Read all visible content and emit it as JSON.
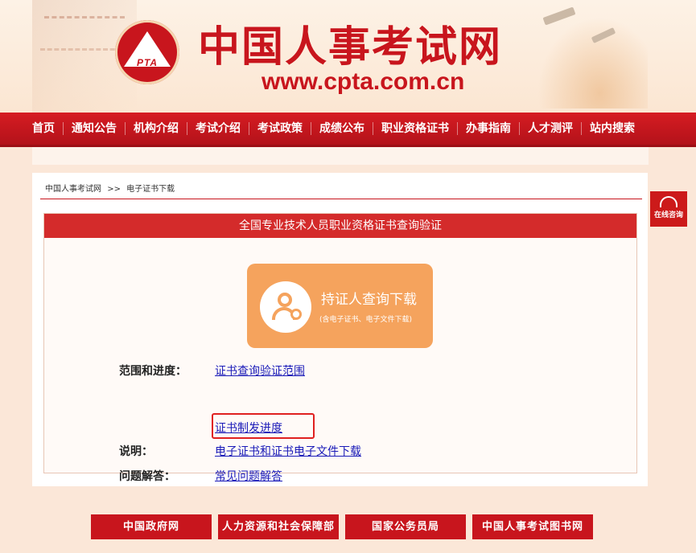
{
  "header": {
    "logo_text": "PTA",
    "site_name": "中国人事考试网",
    "site_url": "www.cpta.com.cn"
  },
  "nav": {
    "items": [
      "首页",
      "通知公告",
      "机构介绍",
      "考试介绍",
      "考试政策",
      "成绩公布",
      "职业资格证书",
      "办事指南",
      "人才测评",
      "站内搜索"
    ]
  },
  "breadcrumb": {
    "home": "中国人事考试网",
    "separator": ">>",
    "current": "电子证书下载"
  },
  "panel": {
    "title": "全国专业技术人员职业资格证书查询验证",
    "query_card": {
      "title": "持证人查询下载",
      "subtitle": "(含电子证书、电子文件下载)"
    },
    "rows": {
      "scope_label": "范围和进度：",
      "scope_link": "证书查询验证范围",
      "progress_link": "证书制发进度",
      "note_label": "说明：",
      "note_link": "电子证书和证书电子文件下载",
      "faq_label": "问题解答：",
      "faq_link": "常见问题解答"
    }
  },
  "side_chat": {
    "label": "在线咨询"
  },
  "footer": {
    "links": [
      "中国政府网",
      "人力资源和社会保障部",
      "国家公务员局",
      "中国人事考试图书网"
    ]
  },
  "colors": {
    "brand_red": "#c8151d",
    "card_orange": "#f5a35d",
    "link_blue": "#1a1ab8",
    "highlight_red": "#e02020"
  }
}
